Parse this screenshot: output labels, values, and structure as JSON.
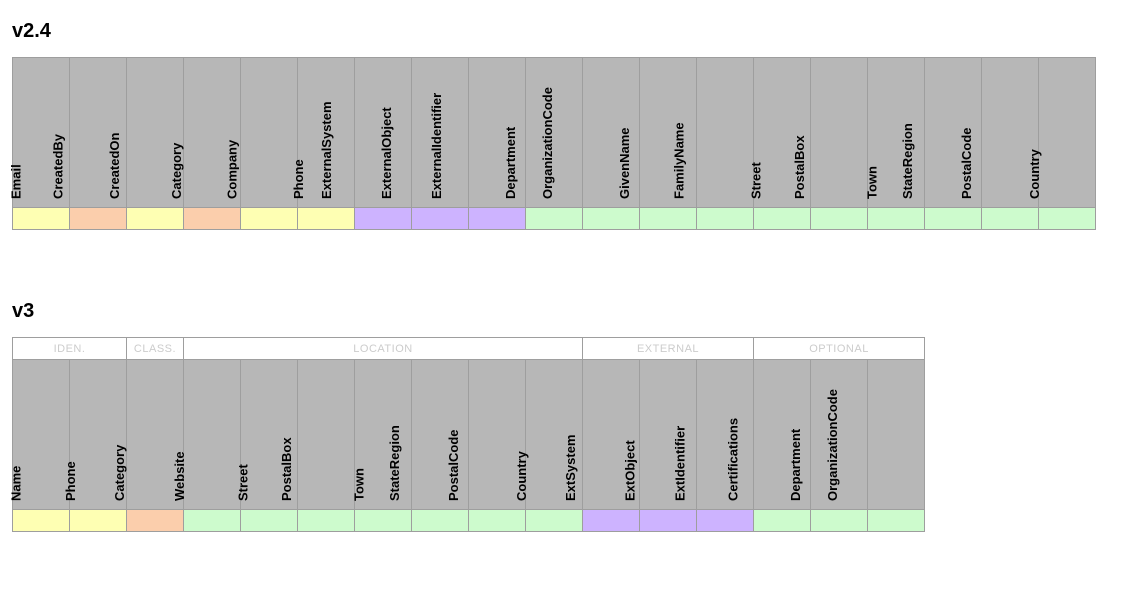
{
  "sections": {
    "v24": {
      "title": "v2.4",
      "columns": [
        {
          "label": "Email",
          "color": "yellow"
        },
        {
          "label": "CreatedBy",
          "color": "orange"
        },
        {
          "label": "CreatedOn",
          "color": "yellow"
        },
        {
          "label": "Category",
          "color": "orange"
        },
        {
          "label": "Company",
          "color": "yellow"
        },
        {
          "label": "Phone",
          "color": "yellow"
        },
        {
          "label": "ExternalSystem",
          "color": "purple"
        },
        {
          "label": "ExternalObject",
          "color": "purple"
        },
        {
          "label": "ExternalIdentifier",
          "color": "purple"
        },
        {
          "label": "Department",
          "color": "green"
        },
        {
          "label": "OrganizationCode",
          "color": "green"
        },
        {
          "label": "GivenName",
          "color": "green"
        },
        {
          "label": "FamilyName",
          "color": "green"
        },
        {
          "label": "Street",
          "color": "green"
        },
        {
          "label": "PostalBox",
          "color": "green"
        },
        {
          "label": "Town",
          "color": "green"
        },
        {
          "label": "StateRegion",
          "color": "green"
        },
        {
          "label": "PostalCode",
          "color": "green"
        },
        {
          "label": "Country",
          "color": "green"
        }
      ]
    },
    "v3": {
      "title": "v3",
      "groups": [
        {
          "label": "IDEN.",
          "span": 2
        },
        {
          "label": "CLASS.",
          "span": 1
        },
        {
          "label": "LOCATION",
          "span": 7
        },
        {
          "label": "EXTERNAL",
          "span": 3
        },
        {
          "label": "OPTIONAL",
          "span": 3
        }
      ],
      "columns": [
        {
          "label": "Name",
          "color": "yellow"
        },
        {
          "label": "Phone",
          "color": "yellow"
        },
        {
          "label": "Category",
          "color": "orange"
        },
        {
          "label": "Website",
          "color": "green"
        },
        {
          "label": "Street",
          "color": "green"
        },
        {
          "label": "PostalBox",
          "color": "green"
        },
        {
          "label": "Town",
          "color": "green"
        },
        {
          "label": "StateRegion",
          "color": "green"
        },
        {
          "label": "PostalCode",
          "color": "green"
        },
        {
          "label": "Country",
          "color": "green"
        },
        {
          "label": "ExtSystem",
          "color": "purple"
        },
        {
          "label": "ExtObject",
          "color": "purple"
        },
        {
          "label": "ExtIdentifier",
          "color": "purple"
        },
        {
          "label": "Certifications",
          "color": "green"
        },
        {
          "label": "Department",
          "color": "green"
        },
        {
          "label": "OrganizationCode",
          "color": "green"
        }
      ]
    }
  }
}
